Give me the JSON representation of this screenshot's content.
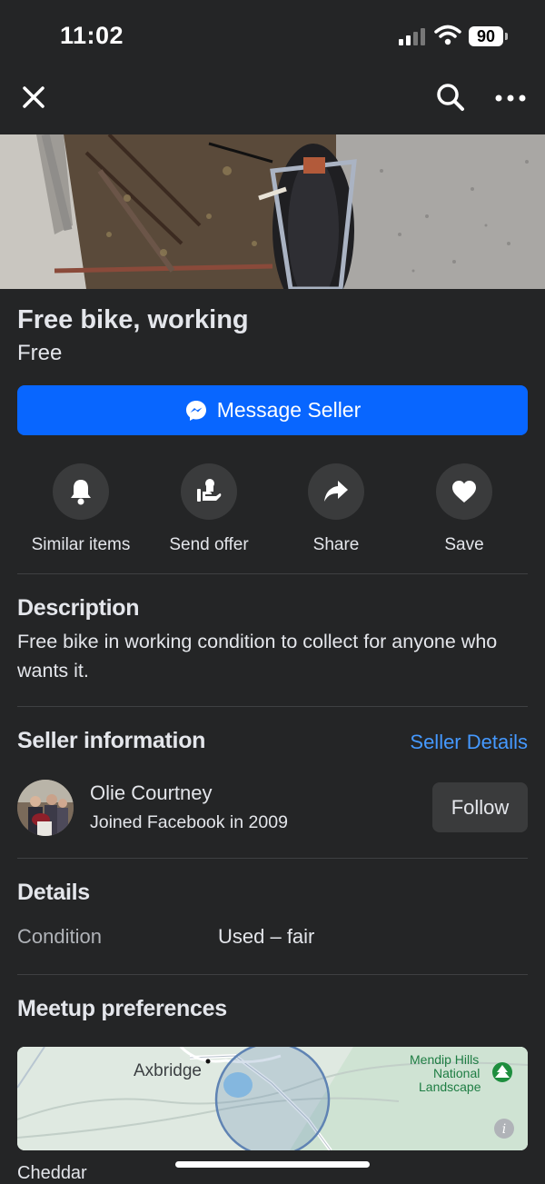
{
  "status": {
    "time": "11:02",
    "battery": "90"
  },
  "topbar": {
    "close_icon": "close-icon",
    "search_icon": "search-icon",
    "more_icon": "more-icon"
  },
  "listing": {
    "title": "Free bike, working",
    "price": "Free",
    "message_button": "Message Seller"
  },
  "actions": [
    {
      "label": "Similar items",
      "icon": "bell-icon"
    },
    {
      "label": "Send offer",
      "icon": "offer-icon"
    },
    {
      "label": "Share",
      "icon": "share-icon"
    },
    {
      "label": "Save",
      "icon": "heart-icon"
    }
  ],
  "description": {
    "heading": "Description",
    "text": "Free bike in working condition to collect for anyone who wants it."
  },
  "seller": {
    "heading": "Seller information",
    "details_link": "Seller Details",
    "name": "Olie Courtney",
    "joined": "Joined Facebook in 2009",
    "follow": "Follow"
  },
  "details": {
    "heading": "Details",
    "condition_label": "Condition",
    "condition_value": "Used – fair"
  },
  "meetup": {
    "heading": "Meetup preferences",
    "map_labels": {
      "town": "Axbridge",
      "park_line1": "Mendip Hills",
      "park_line2": "National",
      "park_line3": "Landscape"
    },
    "below_map": "Cheddar"
  },
  "colors": {
    "background": "#242526",
    "accent": "#0866ff",
    "link": "#4599ff"
  }
}
